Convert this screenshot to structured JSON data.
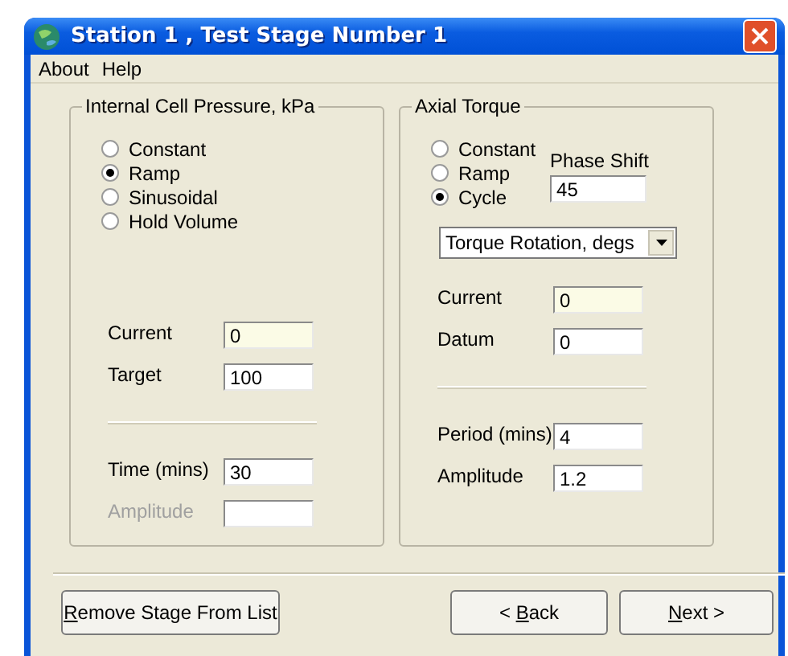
{
  "window": {
    "title": "Station 1 , Test Stage Number 1"
  },
  "menu": [
    "About",
    "Help"
  ],
  "pressure": {
    "title": "Internal Cell Pressure, kPa",
    "modes": [
      {
        "label": "Constant",
        "selected": false
      },
      {
        "label": "Ramp",
        "selected": true
      },
      {
        "label": "Sinusoidal",
        "selected": false
      },
      {
        "label": "Hold Volume",
        "selected": false
      }
    ],
    "fields_top": [
      {
        "label": "Current",
        "value": "0",
        "kind": "readonly",
        "disabled": false
      },
      {
        "label": "Target",
        "value": "100",
        "kind": "edit",
        "disabled": false
      }
    ],
    "fields_bottom": [
      {
        "label": "Time (mins)",
        "value": "30",
        "kind": "edit",
        "disabled": false
      },
      {
        "label": "Amplitude",
        "kind": "edit",
        "disabled": true
      }
    ]
  },
  "torque": {
    "title": "Axial Torque",
    "modes": [
      {
        "label": "Constant",
        "selected": false
      },
      {
        "label": "Ramp",
        "selected": false
      },
      {
        "label": "Cycle",
        "selected": true
      }
    ],
    "phase_shift": {
      "label": "Phase Shift",
      "value": "45"
    },
    "dropdown": {
      "value": "Torque Rotation, degs"
    },
    "fields_top": [
      {
        "label": "Current",
        "value": "0",
        "kind": "readonly",
        "disabled": false
      },
      {
        "label": "Datum",
        "value": "0",
        "kind": "edit",
        "disabled": false
      }
    ],
    "fields_bottom": [
      {
        "label": "Period (mins)",
        "value": "4",
        "kind": "edit",
        "disabled": false
      },
      {
        "label": "Amplitude",
        "value": "1.2",
        "kind": "edit",
        "disabled": false
      }
    ]
  },
  "buttons": [
    {
      "mnemonic": "R",
      "after": "emove Stage From List"
    },
    {
      "before": "< ",
      "mnemonic": "B",
      "after": "ack"
    },
    {
      "mnemonic": "N",
      "after": "ext >"
    }
  ]
}
